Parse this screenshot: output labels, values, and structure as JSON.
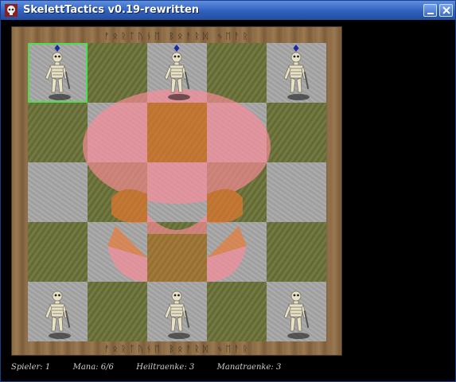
{
  "window": {
    "title": "SkelettTactics v0.19-rewritten"
  },
  "board": {
    "runes_top": "ᚠᛟᚱᛏᚢᚾᛖ ᛒᛟᚨᚱᛞ ᛃᛖᚨᚱ",
    "runes_bottom": "ᚠᛟᚱᛏᚢᚾᛖ ᛒᛟᚨᚱᛞ ᛃᛖᚨᚱ",
    "size": 5,
    "selected_cell": "a5",
    "player_pieces": [
      "a1",
      "c1",
      "e1"
    ],
    "enemy_pieces": [
      "a5",
      "c5",
      "e5"
    ]
  },
  "status": {
    "spieler_label": "Spieler:",
    "spieler_value": "1",
    "mana_label": "Mana:",
    "mana_value": "6/6",
    "heiltraenke_label": "Heiltraenke:",
    "heiltraenke_value": "3",
    "manatraenke_label": "Manatraenke:",
    "manatraenke_value": "3"
  },
  "colors": {
    "titlebar": "#2f5fbd",
    "board_light": "#a8a8a8",
    "board_dark": "#6c7238",
    "highlight": "#4ddd4d",
    "skull_pink": "#ff8c9a",
    "skull_orange": "#f07830",
    "enemy_marker": "#1a2aa0"
  }
}
